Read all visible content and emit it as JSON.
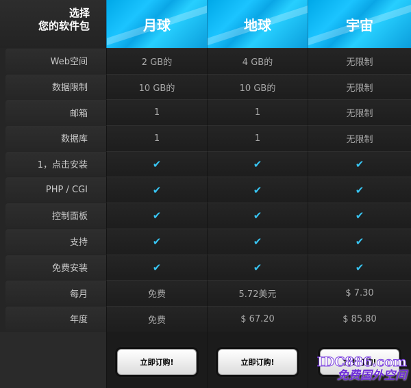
{
  "header": {
    "corner_line1": "选择",
    "corner_line2": "您的软件包",
    "plans": [
      "月球",
      "地球",
      "宇宙"
    ]
  },
  "rows": [
    {
      "label": "Web空间",
      "values": [
        "2 GB的",
        "4 GB的",
        "无限制"
      ]
    },
    {
      "label": "数据限制",
      "values": [
        "10 GB的",
        "10 GB的",
        "无限制"
      ]
    },
    {
      "label": "邮箱",
      "values": [
        "1",
        "1",
        "无限制"
      ]
    },
    {
      "label": "数据库",
      "values": [
        "1",
        "1",
        "无限制"
      ]
    },
    {
      "label": "1，点击安装",
      "values": [
        "✔",
        "✔",
        "✔"
      ]
    },
    {
      "label": "PHP / CGI",
      "values": [
        "✔",
        "✔",
        "✔"
      ]
    },
    {
      "label": "控制面板",
      "values": [
        "✔",
        "✔",
        "✔"
      ]
    },
    {
      "label": "支持",
      "values": [
        "✔",
        "✔",
        "✔"
      ]
    },
    {
      "label": "免费安装",
      "values": [
        "✔",
        "✔",
        "✔"
      ]
    },
    {
      "label": "每月",
      "values": [
        "免费",
        "5.72美元",
        "$ 7.30"
      ]
    },
    {
      "label": "年度",
      "values": [
        "免费",
        "$ 67.20",
        "$ 85.80"
      ]
    }
  ],
  "footer": {
    "order_label": "立即订购!"
  },
  "watermark": {
    "line1": "IDC886.com",
    "line2": "免费国外空间"
  },
  "colors": {
    "header_blue": "#1bb8f5",
    "check": "#38c6f4",
    "background": "#252525"
  }
}
